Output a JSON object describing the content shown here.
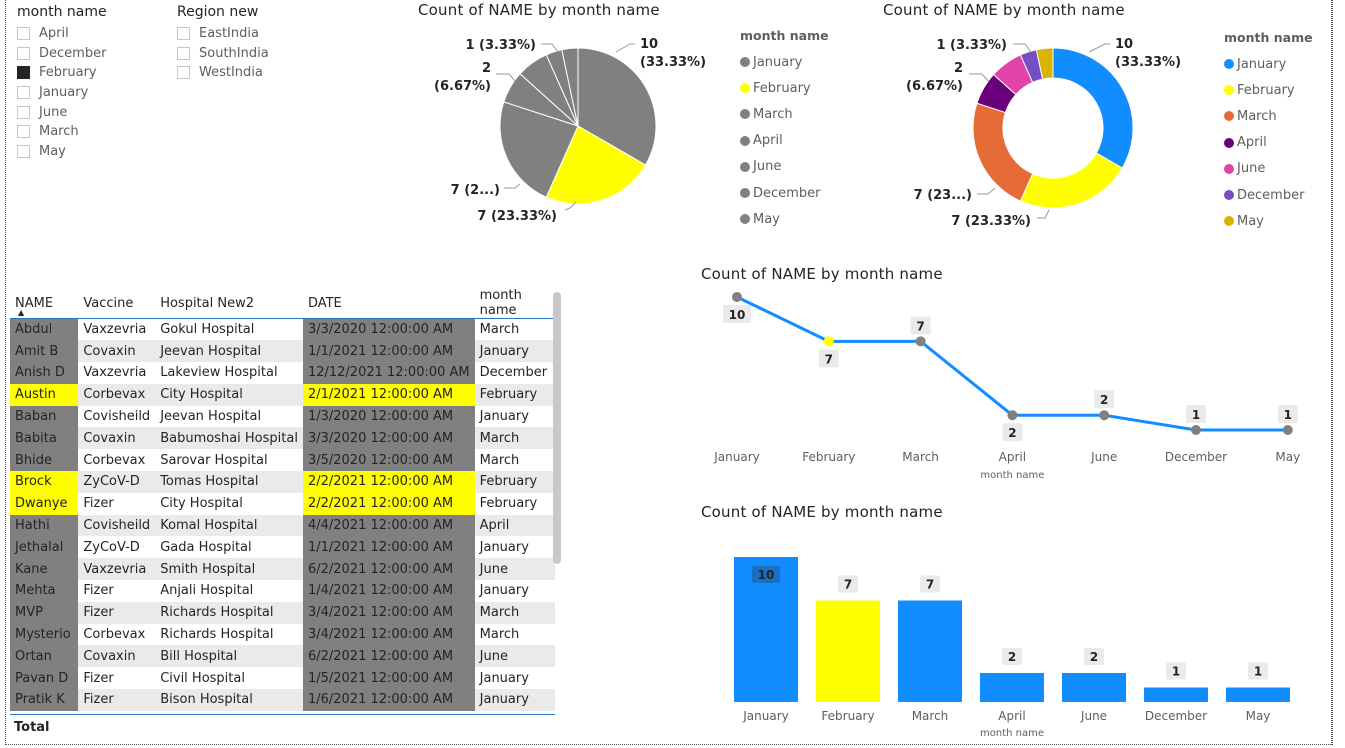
{
  "colors": {
    "grey": "#808080",
    "yellow": "#ffff00",
    "blue": "#118dff",
    "orange": "#e66c37",
    "purple": "#6b007b",
    "pink": "#e044a7",
    "violet": "#744ec2",
    "gold": "#d9b300"
  },
  "slicer_month": {
    "title": "month name",
    "items": [
      {
        "label": "April",
        "checked": false
      },
      {
        "label": "December",
        "checked": false
      },
      {
        "label": "February",
        "checked": true
      },
      {
        "label": "January",
        "checked": false
      },
      {
        "label": "June",
        "checked": false
      },
      {
        "label": "March",
        "checked": false
      },
      {
        "label": "May",
        "checked": false
      }
    ]
  },
  "slicer_region": {
    "title": "Region new",
    "items": [
      {
        "label": "EastIndia",
        "checked": false
      },
      {
        "label": "SouthIndia",
        "checked": false
      },
      {
        "label": "WestIndia",
        "checked": false
      }
    ]
  },
  "pie_legend": {
    "title": "month name",
    "items": [
      {
        "label": "January",
        "color": "#808080"
      },
      {
        "label": "February",
        "color": "#ffff00"
      },
      {
        "label": "March",
        "color": "#808080"
      },
      {
        "label": "April",
        "color": "#808080"
      },
      {
        "label": "June",
        "color": "#808080"
      },
      {
        "label": "December",
        "color": "#808080"
      },
      {
        "label": "May",
        "color": "#808080"
      }
    ]
  },
  "donut_legend": {
    "title": "month name",
    "items": [
      {
        "label": "January",
        "color": "#118dff"
      },
      {
        "label": "February",
        "color": "#ffff00"
      },
      {
        "label": "March",
        "color": "#e66c37"
      },
      {
        "label": "April",
        "color": "#6b007b"
      },
      {
        "label": "June",
        "color": "#e044a7"
      },
      {
        "label": "December",
        "color": "#744ec2"
      },
      {
        "label": "May",
        "color": "#d9b300"
      }
    ]
  },
  "table": {
    "columns": [
      "NAME",
      "Vaccine",
      "Hospital New2",
      "DATE",
      "month name"
    ],
    "rows": [
      {
        "name": "Abdul",
        "vaccine": "Vaxzevria",
        "hospital": "Gokul Hospital",
        "date": "3/3/2020 12:00:00 AM",
        "month": "March",
        "hl": "grey"
      },
      {
        "name": "Amit B",
        "vaccine": "Covaxin",
        "hospital": "Jeevan Hospital",
        "date": "1/1/2021 12:00:00 AM",
        "month": "January",
        "hl": "grey"
      },
      {
        "name": "Anish D",
        "vaccine": "Vaxzevria",
        "hospital": "Lakeview Hospital",
        "date": "12/12/2021 12:00:00 AM",
        "month": "December",
        "hl": "grey"
      },
      {
        "name": "Austin",
        "vaccine": "Corbevax",
        "hospital": "City Hospital",
        "date": "2/1/2021 12:00:00 AM",
        "month": "February",
        "hl": "yellow"
      },
      {
        "name": "Baban",
        "vaccine": "Covisheild",
        "hospital": "Jeevan Hospital",
        "date": "1/3/2020 12:00:00 AM",
        "month": "January",
        "hl": "grey"
      },
      {
        "name": "Babita",
        "vaccine": "Covaxin",
        "hospital": "Babumoshai Hospital",
        "date": "3/3/2020 12:00:00 AM",
        "month": "March",
        "hl": "grey"
      },
      {
        "name": "Bhide",
        "vaccine": "Corbevax",
        "hospital": "Sarovar Hospital",
        "date": "3/5/2020 12:00:00 AM",
        "month": "March",
        "hl": "grey"
      },
      {
        "name": "Brock",
        "vaccine": "ZyCoV-D",
        "hospital": "Tomas Hospital",
        "date": "2/2/2021 12:00:00 AM",
        "month": "February",
        "hl": "yellow"
      },
      {
        "name": "Dwanye",
        "vaccine": "Fizer",
        "hospital": "City Hospital",
        "date": "2/2/2021 12:00:00 AM",
        "month": "February",
        "hl": "yellow"
      },
      {
        "name": "Hathi",
        "vaccine": "Covisheild",
        "hospital": "Komal Hospital",
        "date": "4/4/2021 12:00:00 AM",
        "month": "April",
        "hl": "grey"
      },
      {
        "name": "Jethalal",
        "vaccine": "ZyCoV-D",
        "hospital": "Gada Hospital",
        "date": "1/1/2021 12:00:00 AM",
        "month": "January",
        "hl": "grey"
      },
      {
        "name": "Kane",
        "vaccine": "Vaxzevria",
        "hospital": "Smith Hospital",
        "date": "6/2/2021 12:00:00 AM",
        "month": "June",
        "hl": "grey"
      },
      {
        "name": "Mehta",
        "vaccine": "Fizer",
        "hospital": "Anjali Hospital",
        "date": "1/4/2021 12:00:00 AM",
        "month": "January",
        "hl": "grey"
      },
      {
        "name": "MVP",
        "vaccine": "Fizer",
        "hospital": "Richards Hospital",
        "date": "3/4/2021 12:00:00 AM",
        "month": "March",
        "hl": "grey"
      },
      {
        "name": "Mysterio",
        "vaccine": "Corbevax",
        "hospital": "Richards Hospital",
        "date": "3/4/2021 12:00:00 AM",
        "month": "March",
        "hl": "grey"
      },
      {
        "name": "Ortan",
        "vaccine": "Covaxin",
        "hospital": "Bill Hospital",
        "date": "6/2/2021 12:00:00 AM",
        "month": "June",
        "hl": "grey"
      },
      {
        "name": "Pavan D",
        "vaccine": "Fizer",
        "hospital": "Civil Hospital",
        "date": "1/5/2021 12:00:00 AM",
        "month": "January",
        "hl": "grey"
      },
      {
        "name": "Pratik K",
        "vaccine": "Fizer",
        "hospital": "Bison Hospital",
        "date": "1/6/2021 12:00:00 AM",
        "month": "January",
        "hl": "grey"
      }
    ],
    "total_label": "Total"
  },
  "chart_data": [
    {
      "type": "pie",
      "title": "Count of NAME by month name",
      "slices": [
        {
          "label": "January",
          "value": 10,
          "color": "#808080",
          "data_label": "10\n(33.33%)"
        },
        {
          "label": "February",
          "value": 7,
          "color": "#ffff00",
          "data_label": "7 (23.33%)"
        },
        {
          "label": "March",
          "value": 7,
          "color": "#808080",
          "data_label": "7 (2...)"
        },
        {
          "label": "April",
          "value": 2,
          "color": "#808080",
          "data_label": "2\n(6.67%)"
        },
        {
          "label": "June",
          "value": 2,
          "color": "#808080",
          "data_label": ""
        },
        {
          "label": "December",
          "value": 1,
          "color": "#808080",
          "data_label": "1 (3.33%)"
        },
        {
          "label": "May",
          "value": 1,
          "color": "#808080",
          "data_label": ""
        }
      ]
    },
    {
      "type": "pie",
      "subtype": "donut",
      "title": "Count of NAME by month name",
      "slices": [
        {
          "label": "January",
          "value": 10,
          "color": "#118dff",
          "data_label": "10\n(33.33%)"
        },
        {
          "label": "February",
          "value": 7,
          "color": "#ffff00",
          "data_label": "7 (23.33%)"
        },
        {
          "label": "March",
          "value": 7,
          "color": "#e66c37",
          "data_label": "7 (23...)"
        },
        {
          "label": "April",
          "value": 2,
          "color": "#6b007b",
          "data_label": "2\n(6.67%)"
        },
        {
          "label": "June",
          "value": 2,
          "color": "#e044a7",
          "data_label": ""
        },
        {
          "label": "December",
          "value": 1,
          "color": "#744ec2",
          "data_label": "1 (3.33%)"
        },
        {
          "label": "May",
          "value": 1,
          "color": "#d9b300",
          "data_label": ""
        }
      ]
    },
    {
      "type": "line",
      "title": "Count of NAME by month name",
      "xlabel": "month name",
      "categories": [
        "January",
        "February",
        "March",
        "April",
        "June",
        "December",
        "May"
      ],
      "values": [
        10,
        7,
        7,
        2,
        2,
        1,
        1
      ],
      "highlight": "February"
    },
    {
      "type": "bar",
      "title": "Count of NAME by month name",
      "xlabel": "month name",
      "categories": [
        "January",
        "February",
        "March",
        "April",
        "June",
        "December",
        "May"
      ],
      "values": [
        10,
        7,
        7,
        2,
        2,
        1,
        1
      ],
      "highlight": "February",
      "ylim": [
        0,
        10
      ]
    }
  ]
}
